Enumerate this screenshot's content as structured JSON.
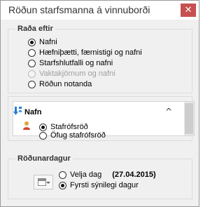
{
  "window": {
    "title": "Röðun starfsmanna á vinnuborði",
    "close_glyph": "✕"
  },
  "sort_by": {
    "label": "Raða eftir",
    "options": [
      {
        "label": "Nafni",
        "checked": true,
        "disabled": false
      },
      {
        "label": "Hæfniþætti, færnistigi og nafni",
        "checked": false,
        "disabled": false
      },
      {
        "label": "Starfshlutfalli og nafni",
        "checked": false,
        "disabled": false
      },
      {
        "label": "Vaktakjörnum og nafni",
        "checked": false,
        "disabled": true
      },
      {
        "label": "Röðun notanda",
        "checked": false,
        "disabled": false
      }
    ]
  },
  "name_section": {
    "title": "Nafn",
    "icons": [
      "sort-down-arrow-icon",
      "person-icon"
    ],
    "options": [
      {
        "label": "Stafrófsröð",
        "checked": true
      },
      {
        "label": "Öfug stafrófsröð",
        "checked": false
      }
    ],
    "chevron": "^"
  },
  "sort_day": {
    "label": "Röðunardagur",
    "options": [
      {
        "label": "Velja dag",
        "checked": false
      },
      {
        "label": "Fyrsti sýnilegi dagur",
        "checked": true
      }
    ],
    "date": "(27.04.2015)"
  },
  "colors": {
    "close_button": "#c75050",
    "window_bg": "#f0f0f0"
  }
}
